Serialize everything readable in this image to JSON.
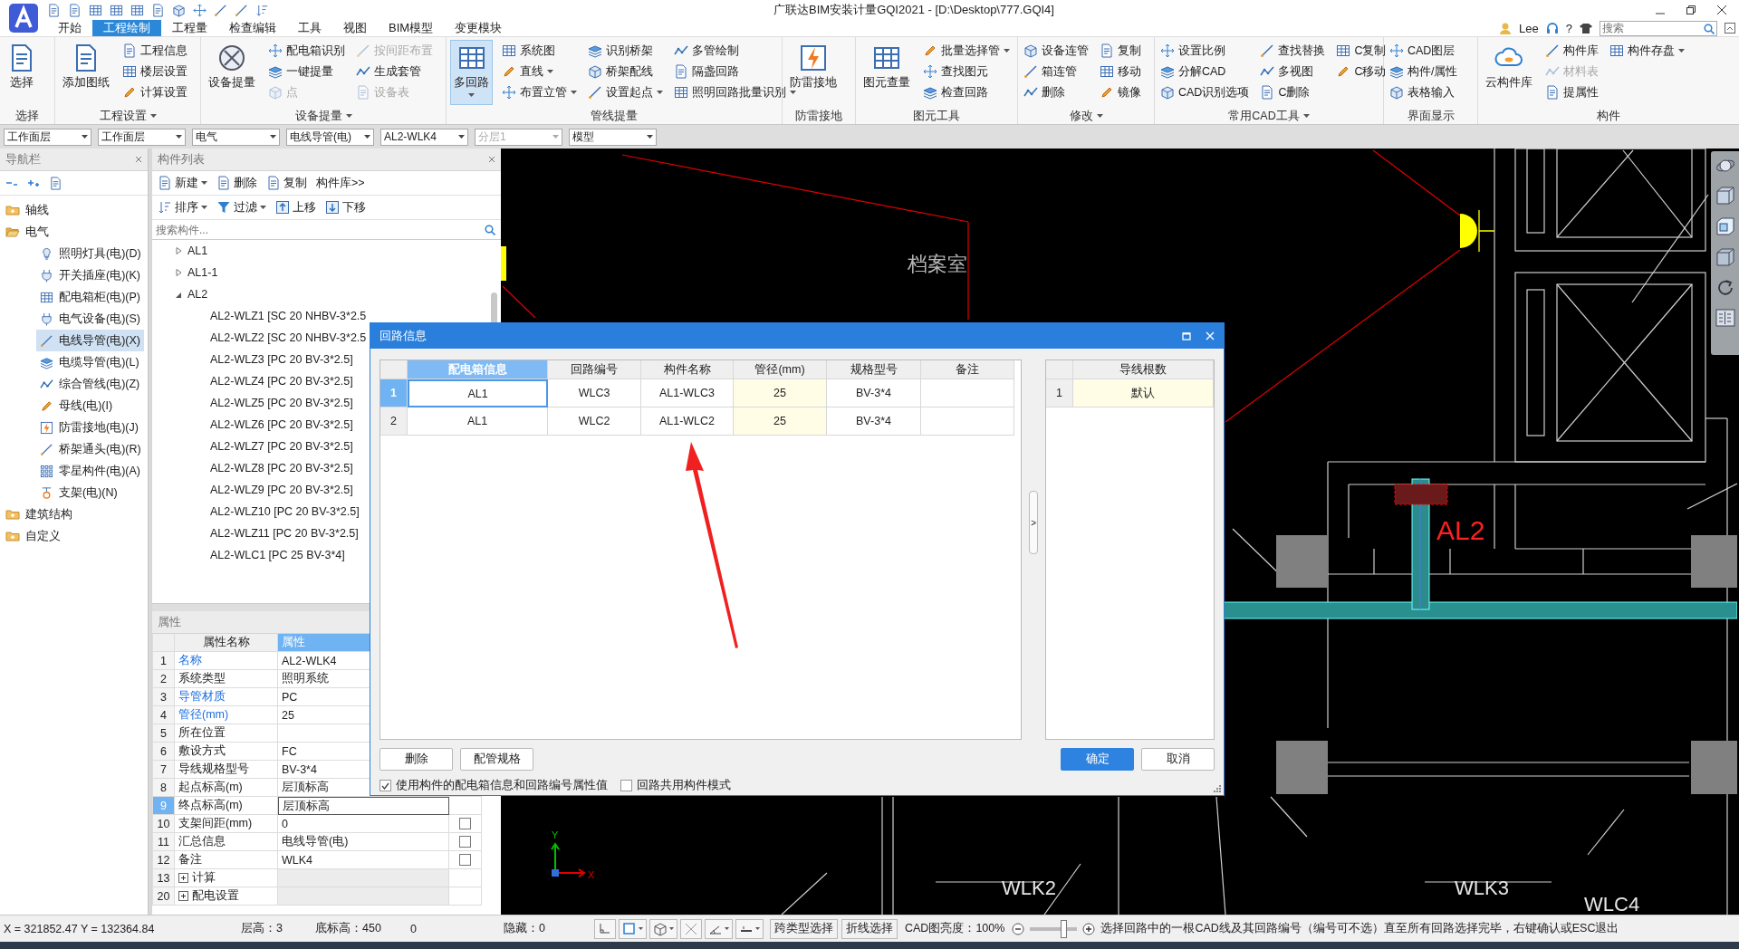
{
  "title_bar": {
    "title": "广联达BIM安装计量GQI2021 - [D:\\Desktop\\777.GQI4]"
  },
  "menu_tabs": [
    {
      "label": "开始",
      "selected": false
    },
    {
      "label": "工程绘制",
      "selected": true
    },
    {
      "label": "工程量",
      "selected": false
    },
    {
      "label": "检查编辑",
      "selected": false
    },
    {
      "label": "工具",
      "selected": false
    },
    {
      "label": "视图",
      "selected": false
    },
    {
      "label": "BIM模型",
      "selected": false
    },
    {
      "label": "变更模块",
      "selected": false
    }
  ],
  "user": {
    "name": "Lee",
    "help": "?"
  },
  "search": {
    "placeholder": "搜索"
  },
  "ribbon": [
    {
      "label": "选择",
      "items": [
        {
          "kind": "large",
          "label": "选择",
          "dropdown": false,
          "selected": false
        }
      ]
    },
    {
      "label": "工程设置",
      "menu": true,
      "items": [
        {
          "kind": "large",
          "label": "添加图纸",
          "dropdown": false,
          "selected": false
        },
        {
          "kind": "column",
          "buttons": [
            {
              "label": "工程信息",
              "disabled": false,
              "dropdown": false
            },
            {
              "label": "楼层设置",
              "disabled": false,
              "dropdown": false
            },
            {
              "label": "计算设置",
              "disabled": false,
              "dropdown": false
            }
          ]
        }
      ]
    },
    {
      "label": "设备提量",
      "menu": true,
      "items": [
        {
          "kind": "large",
          "label": "设备提量",
          "dropdown": false,
          "selected": false
        },
        {
          "kind": "column",
          "buttons": [
            {
              "label": "配电箱识别",
              "disabled": false,
              "dropdown": false
            },
            {
              "label": "一键提量",
              "disabled": false,
              "dropdown": false
            },
            {
              "label": "点",
              "disabled": true,
              "dropdown": false
            }
          ]
        },
        {
          "kind": "column",
          "buttons": [
            {
              "label": "按间距布置",
              "disabled": true,
              "dropdown": false
            },
            {
              "label": "生成套管",
              "disabled": false,
              "dropdown": false
            },
            {
              "label": "设备表",
              "disabled": true,
              "dropdown": false
            }
          ]
        }
      ]
    },
    {
      "label": "管线提量",
      "items": [
        {
          "kind": "large",
          "label": "多回路",
          "dropdown": true,
          "selected": true
        },
        {
          "kind": "column",
          "buttons": [
            {
              "label": "系统图",
              "disabled": false,
              "dropdown": false
            },
            {
              "label": "直线",
              "disabled": false,
              "dropdown": true
            },
            {
              "label": "布置立管",
              "disabled": false,
              "dropdown": true
            }
          ]
        },
        {
          "kind": "column",
          "buttons": [
            {
              "label": "识别桥架",
              "disabled": false,
              "dropdown": false
            },
            {
              "label": "桥架配线",
              "disabled": false,
              "dropdown": false
            },
            {
              "label": "设置起点",
              "disabled": false,
              "dropdown": true
            }
          ]
        },
        {
          "kind": "column",
          "buttons": [
            {
              "label": "多管绘制",
              "disabled": false,
              "dropdown": false
            },
            {
              "label": "隔盏回路",
              "disabled": false,
              "dropdown": false
            },
            {
              "label": "照明回路批量识别",
              "disabled": false,
              "dropdown": true
            }
          ]
        }
      ]
    },
    {
      "label": "防雷接地",
      "items": [
        {
          "kind": "large",
          "label": "防雷接地",
          "dropdown": false,
          "selected": false
        }
      ]
    },
    {
      "label": "图元工具",
      "items": [
        {
          "kind": "large",
          "label": "图元查量",
          "dropdown": false,
          "selected": false
        },
        {
          "kind": "column",
          "buttons": [
            {
              "label": "批量选择管",
              "disabled": false,
              "dropdown": true
            },
            {
              "label": "查找图元",
              "disabled": false,
              "dropdown": false
            },
            {
              "label": "检查回路",
              "disabled": false,
              "dropdown": false
            }
          ]
        }
      ]
    },
    {
      "label": "修改",
      "menu": true,
      "items": [
        {
          "kind": "column",
          "buttons": [
            {
              "label": "设备连管",
              "disabled": false,
              "dropdown": false
            },
            {
              "label": "箱连管",
              "disabled": false,
              "dropdown": false
            },
            {
              "label": "删除",
              "disabled": false,
              "dropdown": false
            }
          ]
        },
        {
          "kind": "column",
          "buttons": [
            {
              "label": "复制",
              "disabled": false,
              "dropdown": false
            },
            {
              "label": "移动",
              "disabled": false,
              "dropdown": false
            },
            {
              "label": "镜像",
              "disabled": false,
              "dropdown": false
            }
          ]
        }
      ]
    },
    {
      "label": "常用CAD工具",
      "menu": true,
      "items": [
        {
          "kind": "column",
          "buttons": [
            {
              "label": "设置比例",
              "disabled": false,
              "dropdown": false
            },
            {
              "label": "分解CAD",
              "disabled": false,
              "dropdown": false
            },
            {
              "label": "CAD识别选项",
              "disabled": false,
              "dropdown": false
            }
          ]
        },
        {
          "kind": "column",
          "buttons": [
            {
              "label": "查找替换",
              "disabled": false,
              "dropdown": false
            },
            {
              "label": "多视图",
              "disabled": false,
              "dropdown": false
            },
            {
              "label": "C删除",
              "disabled": false,
              "dropdown": false
            }
          ]
        },
        {
          "kind": "column",
          "buttons": [
            {
              "label": "C复制",
              "disabled": false,
              "dropdown": false
            },
            {
              "label": "C移动",
              "disabled": false,
              "dropdown": false
            }
          ]
        }
      ]
    },
    {
      "label": "界面显示",
      "items": [
        {
          "kind": "column",
          "buttons": [
            {
              "label": "CAD图层",
              "disabled": false,
              "dropdown": false
            },
            {
              "label": "构件/属性",
              "disabled": false,
              "dropdown": false
            },
            {
              "label": "表格输入",
              "disabled": false,
              "dropdown": false
            }
          ]
        }
      ]
    },
    {
      "label": "构件",
      "items": [
        {
          "kind": "large",
          "label": "云构件库",
          "dropdown": false,
          "selected": false
        },
        {
          "kind": "column",
          "buttons": [
            {
              "label": "构件库",
              "disabled": false,
              "dropdown": false
            },
            {
              "label": "材料表",
              "disabled": true,
              "dropdown": false
            },
            {
              "label": "提属性",
              "disabled": false,
              "dropdown": false
            }
          ]
        },
        {
          "kind": "column",
          "buttons": [
            {
              "label": "构件存盘",
              "disabled": false,
              "dropdown": true
            }
          ]
        }
      ]
    }
  ],
  "selectors": [
    {
      "value": "工作面层",
      "disabled": false
    },
    {
      "value": "工作面层",
      "disabled": false
    },
    {
      "value": "电气",
      "disabled": false
    },
    {
      "value": "电线导管(电)",
      "disabled": false
    },
    {
      "value": "AL2-WLK4",
      "disabled": false
    },
    {
      "value": "分层1",
      "disabled": true
    },
    {
      "value": "模型",
      "disabled": false
    }
  ],
  "nav_panel": {
    "title": "导航栏",
    "tree": [
      {
        "label": "轴线",
        "expanded": false
      },
      {
        "label": "电气",
        "expanded": true,
        "children": [
          {
            "label": "照明灯具(电)(D)",
            "selected": false
          },
          {
            "label": "开关插座(电)(K)",
            "selected": false
          },
          {
            "label": "配电箱柜(电)(P)",
            "selected": false
          },
          {
            "label": "电气设备(电)(S)",
            "selected": false
          },
          {
            "label": "电线导管(电)(X)",
            "selected": true
          },
          {
            "label": "电缆导管(电)(L)",
            "selected": false
          },
          {
            "label": "综合管线(电)(Z)",
            "selected": false
          },
          {
            "label": "母线(电)(I)",
            "selected": false
          },
          {
            "label": "防雷接地(电)(J)",
            "selected": false
          },
          {
            "label": "桥架通头(电)(R)",
            "selected": false
          },
          {
            "label": "零星构件(电)(A)",
            "selected": false
          },
          {
            "label": "支架(电)(N)",
            "selected": false
          }
        ]
      },
      {
        "label": "建筑结构",
        "expanded": false
      },
      {
        "label": "自定义",
        "expanded": false
      }
    ]
  },
  "component_list": {
    "title": "构件列表",
    "toolbar": [
      {
        "label": "新建",
        "dropdown": true
      },
      {
        "label": "删除",
        "dropdown": false
      },
      {
        "label": "复制",
        "dropdown": false
      },
      {
        "label": "构件库>>",
        "dropdown": false
      }
    ],
    "toolbar_2": [
      {
        "label": "排序",
        "dropdown": true
      },
      {
        "label": "过滤",
        "dropdown": true
      },
      {
        "label": "上移",
        "dropdown": false
      },
      {
        "label": "下移",
        "dropdown": false
      }
    ],
    "search": {
      "placeholder": "搜索构件..."
    },
    "tree": [
      {
        "label": "AL1",
        "expanded": false
      },
      {
        "label": "AL1-1",
        "expanded": false
      },
      {
        "label": "AL2",
        "expanded": true,
        "children": [
          {
            "label": "AL2-WLZ1 [SC 20 NHBV-3*2.5"
          },
          {
            "label": "AL2-WLZ2 [SC 20 NHBV-3*2.5"
          },
          {
            "label": "AL2-WLZ3 [PC 20 BV-3*2.5]"
          },
          {
            "label": "AL2-WLZ4 [PC 20 BV-3*2.5]"
          },
          {
            "label": "AL2-WLZ5 [PC 20 BV-3*2.5]"
          },
          {
            "label": "AL2-WLZ6 [PC 20 BV-3*2.5]"
          },
          {
            "label": "AL2-WLZ7 [PC 20 BV-3*2.5]"
          },
          {
            "label": "AL2-WLZ8 [PC 20 BV-3*2.5]"
          },
          {
            "label": "AL2-WLZ9 [PC 20 BV-3*2.5]"
          },
          {
            "label": "AL2-WLZ10 [PC 20 BV-3*2.5]"
          },
          {
            "label": "AL2-WLZ11 [PC 20 BV-3*2.5]"
          },
          {
            "label": "AL2-WLC1 [PC 25 BV-3*4]"
          }
        ]
      }
    ]
  },
  "properties": {
    "title": "属性",
    "columns": [
      {
        "label": "属性名称",
        "selected": false
      },
      {
        "label": "属性",
        "selected": true
      }
    ],
    "rows": [
      {
        "num": "1",
        "kind": "field",
        "name": "名称",
        "value": "AL2-WLK4",
        "highlighted": true,
        "selected": false
      },
      {
        "num": "2",
        "kind": "field",
        "name": "系统类型",
        "value": "照明系统",
        "highlighted": false,
        "selected": false
      },
      {
        "num": "3",
        "kind": "field",
        "name": "导管材质",
        "value": "PC",
        "highlighted": true,
        "selected": false
      },
      {
        "num": "4",
        "kind": "field",
        "name": "管径(mm)",
        "value": "25",
        "highlighted": true,
        "selected": false
      },
      {
        "num": "5",
        "kind": "field",
        "name": "所在位置",
        "highlighted": false,
        "selected": false
      },
      {
        "num": "6",
        "kind": "field",
        "name": "敷设方式",
        "value": "FC",
        "highlighted": false,
        "selected": false
      },
      {
        "num": "7",
        "kind": "field",
        "name": "导线规格型号",
        "value": "BV-3*4",
        "highlighted": false,
        "selected": false
      },
      {
        "num": "8",
        "kind": "field",
        "name": "起点标高(m)",
        "value": "层顶标高",
        "highlighted": false,
        "selected": false
      },
      {
        "num": "9",
        "kind": "field",
        "name": "终点标高(m)",
        "value": "层顶标高",
        "highlighted": false,
        "selected": true
      },
      {
        "num": "10",
        "kind": "field",
        "name": "支架间距(mm)",
        "value": "0",
        "highlighted": false,
        "selected": false,
        "checked": false
      },
      {
        "num": "11",
        "kind": "field",
        "name": "汇总信息",
        "value": "电线导管(电)",
        "highlighted": false,
        "selected": false,
        "checked": false
      },
      {
        "num": "12",
        "kind": "field",
        "name": "备注",
        "value": "WLK4",
        "highlighted": false,
        "selected": false,
        "checked": false
      },
      {
        "num": "13",
        "kind": "group",
        "name": "计算",
        "selected": false
      },
      {
        "num": "20",
        "kind": "group",
        "name": "配电设置",
        "selected": false
      }
    ]
  },
  "cad": {
    "labels": [
      {
        "kind": "room",
        "text": "档案室"
      },
      {
        "kind": "box",
        "text": "AL2"
      },
      {
        "kind": "circuit",
        "text": "WLK2"
      },
      {
        "kind": "circuit",
        "text": "WLK3"
      },
      {
        "kind": "circuit",
        "text": "WLC4"
      }
    ],
    "axis_x": "X",
    "axis_y": "Y"
  },
  "dialog": {
    "title": "回路信息",
    "table": {
      "columns": [
        {
          "label": "配电箱信息",
          "selected": true,
          "editable": false
        },
        {
          "label": "回路编号",
          "selected": false,
          "editable": false
        },
        {
          "label": "构件名称",
          "selected": false,
          "editable": false
        },
        {
          "label": "管径(mm)",
          "selected": false,
          "editable": true
        },
        {
          "label": "规格型号",
          "selected": false,
          "editable": false
        },
        {
          "label": "备注",
          "selected": false,
          "editable": false
        }
      ],
      "rows": [
        {
          "num": "1",
          "selected": true,
          "cells": [
            "AL1",
            "WLC3",
            "AL1-WLC3",
            "25",
            "BV-3*4"
          ]
        },
        {
          "num": "2",
          "selected": false,
          "cells": [
            "AL1",
            "WLC2",
            "AL1-WLC2",
            "25",
            "BV-3*4"
          ]
        }
      ]
    },
    "wire_table": {
      "columns": [
        {
          "label": "导线根数",
          "selected": false,
          "editable": true
        }
      ],
      "rows": [
        {
          "num": "1",
          "selected": false,
          "cells": [
            "默认"
          ]
        }
      ]
    },
    "splitter": ">",
    "buttons": [
      {
        "label": "删除",
        "primary": false
      },
      {
        "label": "配管规格",
        "primary": false
      }
    ],
    "confirm_buttons": [
      {
        "label": "确定",
        "primary": true
      },
      {
        "label": "取消",
        "primary": false
      }
    ],
    "options": [
      {
        "label": "使用构件的配电箱信息和回路编号属性值",
        "checked": true
      },
      {
        "label": "回路共用构件模式",
        "checked": false
      }
    ]
  },
  "status_bar": {
    "coords": "X = 321852.47 Y = 132364.84",
    "floor_height": "层高：3",
    "base_elevation": "底标高：450",
    "value": "0",
    "hidden": "隐藏：0",
    "buttons": [
      "跨类型选择",
      "折线选择"
    ],
    "brightness": "CAD图亮度：100%",
    "brightness_slider": {
      "level": 0.7
    },
    "message": "选择回路中的一根CAD线及其回路编号（编号可不选）直至所有回路选择完毕，右键确认或ESC退出"
  }
}
